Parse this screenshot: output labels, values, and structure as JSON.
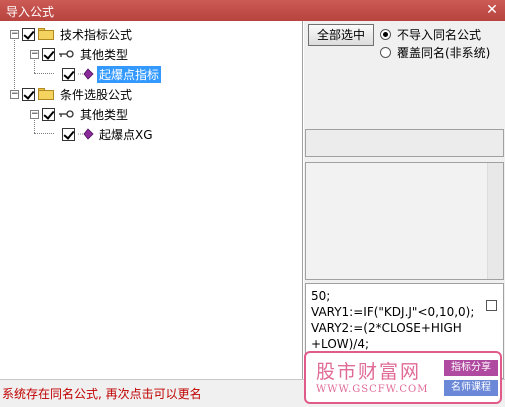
{
  "window": {
    "title": "导入公式",
    "close_glyph": "✕"
  },
  "tree": {
    "nodes": [
      {
        "label": "技术指标公式",
        "expander": "−",
        "checked": true,
        "icon": "folder-icon"
      },
      {
        "label": "其他类型",
        "expander": "−",
        "checked": true,
        "icon": "key-icon"
      },
      {
        "label": "起爆点指标",
        "checked": true,
        "icon": "formula-gem-icon",
        "selected": true
      },
      {
        "label": "条件选股公式",
        "expander": "−",
        "checked": true,
        "icon": "folder-icon"
      },
      {
        "label": "其他类型",
        "expander": "−",
        "checked": true,
        "icon": "key-icon"
      },
      {
        "label": "起爆点XG",
        "checked": true,
        "icon": "formula-gem-icon"
      }
    ]
  },
  "options": {
    "select_all_label": "全部选中",
    "radio_skip_label": "不导入同名公式",
    "radio_overwrite_label": "覆盖同名(非系统)",
    "selected": "skip"
  },
  "code_preview": {
    "lines": [
      "50;",
      "VARY1:=IF(\"KDJ.J\"<0,10,0);",
      "VARY2:=(2*CLOSE+HIGH",
      "+LOW)/4;"
    ]
  },
  "status": {
    "message": "系统存在同名公式, 再次点击可以更名"
  },
  "watermark": {
    "brand": "股市财富网",
    "url": "WWW.GSCFW.COM",
    "tag1": "指标分享",
    "tag2": "名师课程"
  },
  "colors": {
    "titlebar": "#c0504d",
    "selection": "#3399ff",
    "status_text": "#c00000",
    "watermark": "#e05a8a"
  }
}
